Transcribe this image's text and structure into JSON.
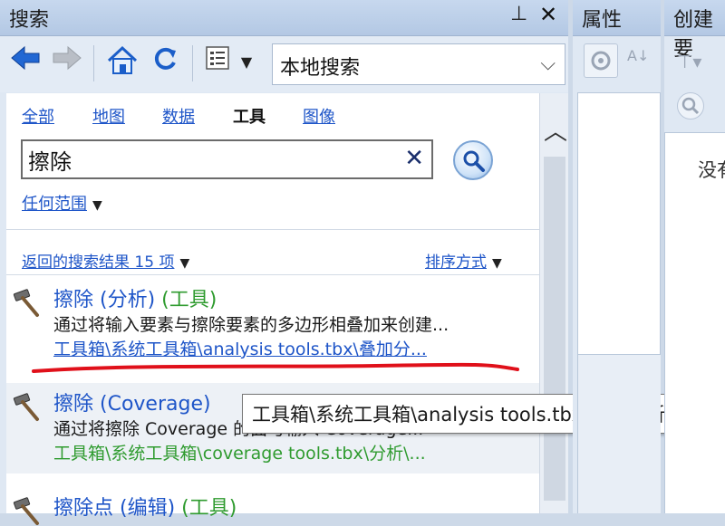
{
  "search_pane": {
    "title": "搜索",
    "toolbar": {
      "location_combo": "本地搜索"
    },
    "tabs": [
      {
        "label": "全部"
      },
      {
        "label": "地图"
      },
      {
        "label": "数据"
      },
      {
        "label": "工具"
      },
      {
        "label": "图像"
      }
    ],
    "search": {
      "value": "擦除",
      "scope_label": "任何范围"
    },
    "results_header": {
      "count_label": "返回的搜索结果 15 项",
      "sort_label": "排序方式"
    },
    "results": [
      {
        "name": "擦除 (分析)",
        "tag": "(工具)",
        "description": "通过将输入要素与擦除要素的多边形相叠加来创建...",
        "path": "工具箱\\系统工具箱\\analysis tools.tbx\\叠加分..."
      },
      {
        "name": "擦除 (Coverage)",
        "tag": "",
        "description": "通过将擦除 Coverage 的面与输入 Coverage...",
        "path": "工具箱\\系统工具箱\\coverage tools.tbx\\分析\\..."
      },
      {
        "name": "擦除点 (编辑)",
        "tag": "(工具)",
        "description": "",
        "path": ""
      }
    ],
    "tooltip": "工具箱\\系统工具箱\\analysis tools.tbx\\叠加分析"
  },
  "properties_pane": {
    "title": "属性"
  },
  "create_pane": {
    "title": "创建要",
    "empty_text": "没有"
  },
  "colors": {
    "link": "#1e55c8",
    "tool_tag": "#2f9b2f",
    "annotation": "#e0101a"
  }
}
